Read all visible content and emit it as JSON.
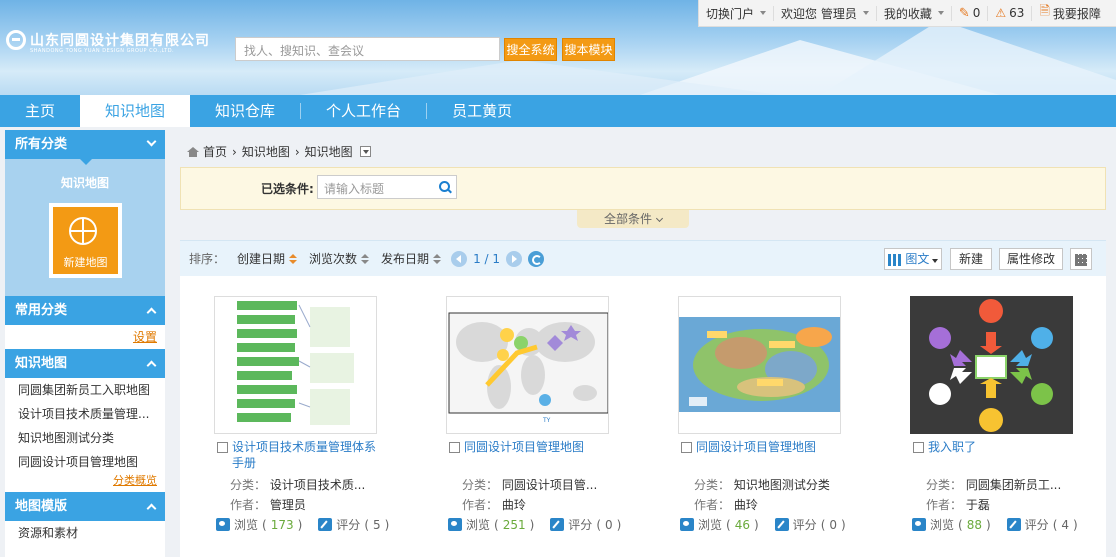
{
  "header": {
    "company_name": "山东同圆设计集团有限公司",
    "company_name_en": "SHANDONG TONG YUAN DESIGN GROUP CO.,LTD.",
    "search_placeholder": "找人、搜知识、查会议",
    "search_all_label": "搜全系统",
    "search_module_label": "搜本模块"
  },
  "topbar": {
    "switch_portal": "切换门户",
    "welcome": "欢迎您 管理员",
    "favorites": "我的收藏",
    "todo_count": "0",
    "alert_count": "63",
    "report": "我要报障"
  },
  "nav": {
    "tabs": [
      "主页",
      "知识地图",
      "知识仓库",
      "个人工作台",
      "员工黄页"
    ],
    "active": "知识地图"
  },
  "sidebar": {
    "all_categories": "所有分类",
    "kmap_title": "知识地图",
    "new_map": "新建地图",
    "common_categories": "常用分类",
    "settings": "设置",
    "kmap_section": "知识地图",
    "kmap_items": [
      "同圆集团新员工入职地图",
      "设计项目技术质量管理...",
      "知识地图测试分类",
      "同圆设计项目管理地图"
    ],
    "overview": "分类概览",
    "template_section": "地图模版",
    "template_items": [
      "资源和素材"
    ]
  },
  "breadcrumb": [
    "首页",
    "知识地图",
    "知识地图"
  ],
  "filter": {
    "selected_label": "已选条件:",
    "title_placeholder": "请输入标题",
    "all_conditions": "全部条件"
  },
  "sortbar": {
    "label": "排序：",
    "keys": [
      "创建日期",
      "浏览次数",
      "发布日期"
    ],
    "page": "1",
    "total": "1",
    "view_mode": "图文",
    "new_label": "新建",
    "edit_props": "属性修改"
  },
  "cards": [
    {
      "title": "设计项目技术质量管理体系手册",
      "category_label": "分类：",
      "category": "设计项目技术质...",
      "author_label": "作者：",
      "author": "管理员",
      "browse_label": "浏览",
      "browse_count": "173",
      "score_label": "评分",
      "score": "5"
    },
    {
      "title": "同圆设计项目管理地图",
      "category_label": "分类：",
      "category": "同圆设计项目管...",
      "author_label": "作者：",
      "author": "曲玲",
      "browse_label": "浏览",
      "browse_count": "251",
      "score_label": "评分",
      "score": "0"
    },
    {
      "title": "同圆设计项目管理地图",
      "category_label": "分类：",
      "category": "知识地图测试分类",
      "author_label": "作者：",
      "author": "曲玲",
      "browse_label": "浏览",
      "browse_count": "46",
      "score_label": "评分",
      "score": "0"
    },
    {
      "title": "我入职了",
      "category_label": "分类：",
      "category": "同圆集团新员工...",
      "author_label": "作者：",
      "author": "于磊",
      "browse_label": "浏览",
      "browse_count": "88",
      "score_label": "评分",
      "score": "4"
    }
  ],
  "colors": {
    "primary": "#3aa3e3",
    "accent": "#f39a14",
    "link": "#2a7cc7"
  }
}
